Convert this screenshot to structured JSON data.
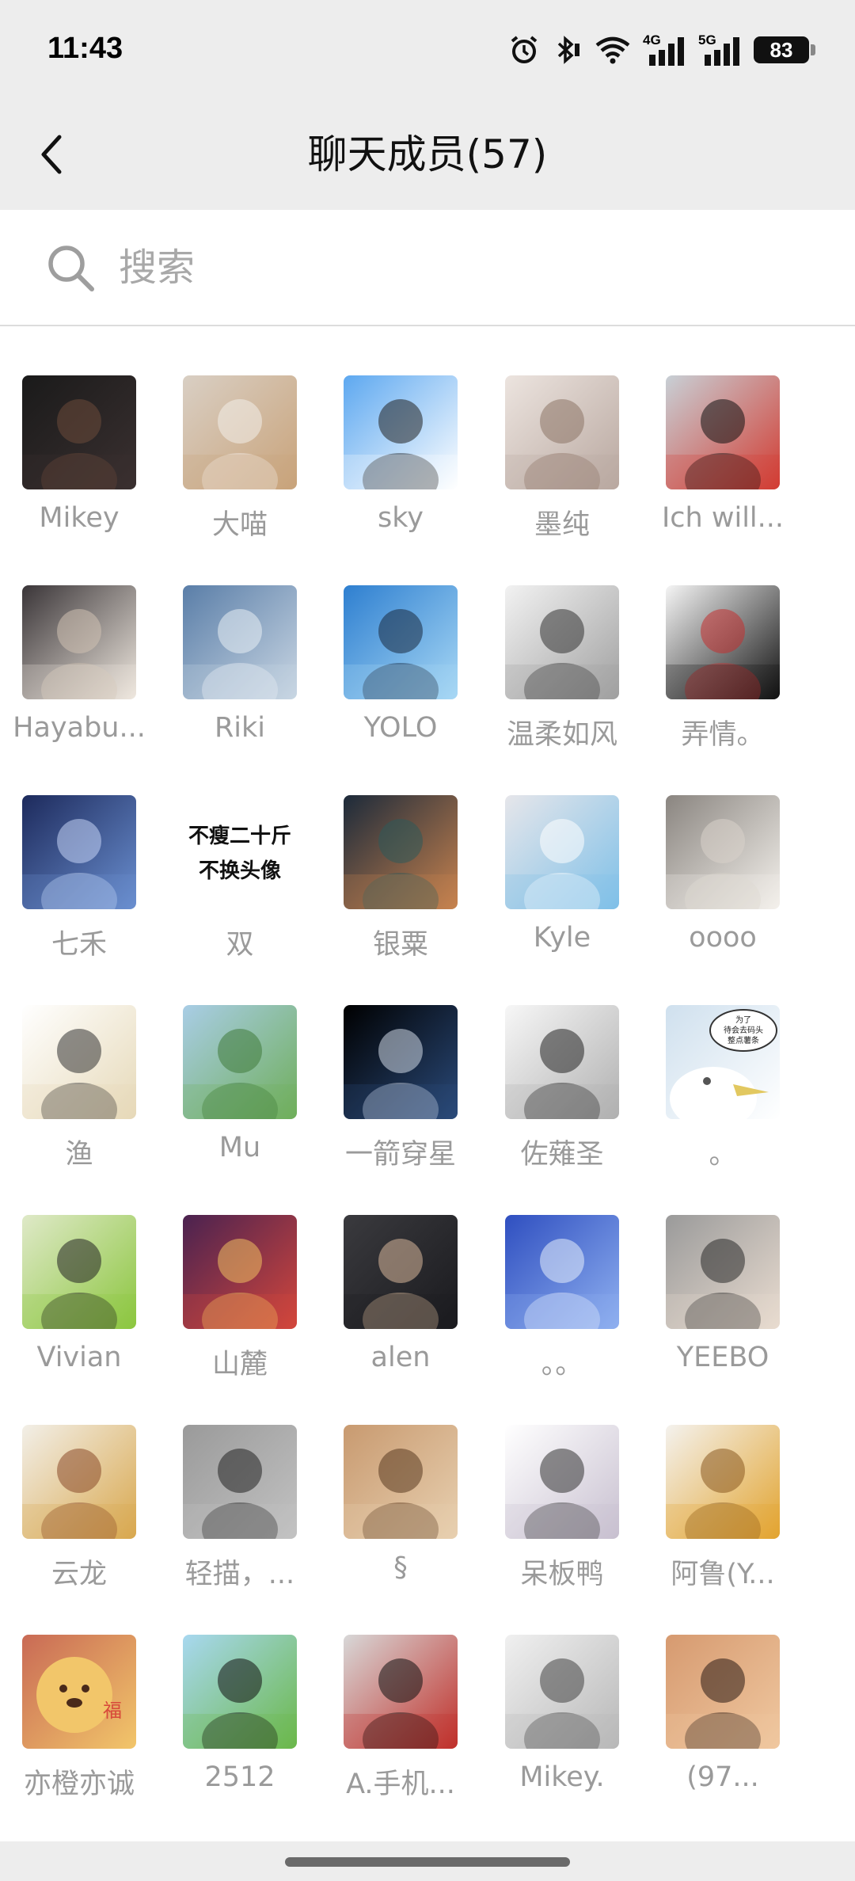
{
  "status": {
    "time": "11:43",
    "network_1": "4G",
    "network_2": "5G",
    "battery": "83"
  },
  "header": {
    "title": "聊天成员(57)"
  },
  "search": {
    "placeholder": "搜索"
  },
  "members": [
    {
      "name": "Mikey",
      "avatar": "night-car-photo",
      "colors": [
        "#1a1a1a",
        "#3a3030",
        "#6b4a3a"
      ]
    },
    {
      "name": "大喵",
      "avatar": "cat-with-bunny-ears",
      "colors": [
        "#d9cfc4",
        "#c9a37a",
        "#f3eee9"
      ]
    },
    {
      "name": "sky",
      "avatar": "cartoon-boy-glasses",
      "colors": [
        "#5da8f0",
        "#ffffff",
        "#222222"
      ]
    },
    {
      "name": "墨纯",
      "avatar": "faded-portrait",
      "colors": [
        "#ece4df",
        "#b9a8a0",
        "#8d7466"
      ]
    },
    {
      "name": "Ich will...",
      "avatar": "red-creature-glasses",
      "colors": [
        "#c8d0d6",
        "#d23c32",
        "#111111"
      ]
    },
    {
      "name": "Hayabu...",
      "avatar": "fluffy-hamster",
      "colors": [
        "#3a3538",
        "#efe8df",
        "#cfc1b2"
      ]
    },
    {
      "name": "Riki",
      "avatar": "clouds-from-above",
      "colors": [
        "#5a7ea8",
        "#c9d6e3",
        "#e8eef4"
      ]
    },
    {
      "name": "YOLO",
      "avatar": "anime-boy-sea",
      "colors": [
        "#2e7fd0",
        "#a8d8f5",
        "#1a2a40"
      ]
    },
    {
      "name": "温柔如风",
      "avatar": "sketch-masked-boy",
      "colors": [
        "#f2f2f2",
        "#a0a0a0",
        "#333333"
      ]
    },
    {
      "name": "弄情。",
      "avatar": "anime-boy-black-hair",
      "colors": [
        "#f5f5f5",
        "#111111",
        "#c33030"
      ]
    },
    {
      "name": "七禾",
      "avatar": "anime-character-blue",
      "colors": [
        "#1d2a5c",
        "#6a8fd0",
        "#c4d4f5"
      ]
    },
    {
      "name": "双",
      "avatar": "text-avatar",
      "colors": [
        "#ffffff",
        "#111111",
        "#111111"
      ],
      "text_lines": [
        "不瘦二十斤",
        "不换头像"
      ]
    },
    {
      "name": "银粟",
      "avatar": "anime-boy-hood",
      "colors": [
        "#1c2a3a",
        "#c7824e",
        "#2d5a5a"
      ]
    },
    {
      "name": "Kyle",
      "avatar": "bear-plush-blue",
      "colors": [
        "#e6e6ea",
        "#7fc0e8",
        "#ffffff"
      ]
    },
    {
      "name": "oooo",
      "avatar": "white-kitten",
      "colors": [
        "#8a8580",
        "#f4f1ec",
        "#d8d2ca"
      ]
    },
    {
      "name": "渔",
      "avatar": "chibi-blond-boy",
      "colors": [
        "#ffffff",
        "#e6d9b8",
        "#333333"
      ]
    },
    {
      "name": "Mu",
      "avatar": "landscape-field",
      "colors": [
        "#a9cde6",
        "#6fae5a",
        "#3f7a3a"
      ]
    },
    {
      "name": "一箭穿星",
      "avatar": "earth-from-space",
      "colors": [
        "#000000",
        "#2a4a7a",
        "#cfd8e6"
      ]
    },
    {
      "name": "佐薙圣",
      "avatar": "manga-girl-headphones",
      "colors": [
        "#f7f7f7",
        "#b0b0b0",
        "#222222"
      ]
    },
    {
      "name": "。",
      "avatar": "seagull-meme",
      "colors": [
        "#cfe0ee",
        "#ffffff",
        "#555555"
      ],
      "text_lines": [
        "为了",
        "待会去码头",
        "整点薯条"
      ]
    },
    {
      "name": "Vivian",
      "avatar": "green-cartoon-cat",
      "colors": [
        "#dfe9c8",
        "#8cc63f",
        "#222222"
      ]
    },
    {
      "name": "山麓",
      "avatar": "chibi-red-hair",
      "colors": [
        "#4a2250",
        "#d2463c",
        "#f0c060"
      ]
    },
    {
      "name": "alen",
      "avatar": "mirror-selfie",
      "colors": [
        "#3a3a3e",
        "#1a1a1e",
        "#d7b79a"
      ]
    },
    {
      "name": "。。",
      "avatar": "blue-hair-anime",
      "colors": [
        "#2f4fc0",
        "#8fb0f0",
        "#e6eefc"
      ]
    },
    {
      "name": "YEEBO",
      "avatar": "boy-with-kitten",
      "colors": [
        "#9a9a9a",
        "#e9dcd0",
        "#2a2a2a"
      ]
    },
    {
      "name": "云龙",
      "avatar": "mooncake-pastry",
      "colors": [
        "#f2efe8",
        "#d9a84e",
        "#8a4a2a"
      ]
    },
    {
      "name": "轻描，...",
      "avatar": "bicycle-wall",
      "colors": [
        "#9a9a9a",
        "#c2c2c2",
        "#222222"
      ]
    },
    {
      "name": "§",
      "avatar": "orange-cat",
      "colors": [
        "#c89a70",
        "#e8d0b0",
        "#5a3a20"
      ]
    },
    {
      "name": "呆板鸭",
      "avatar": "anime-girl-sketch",
      "colors": [
        "#ffffff",
        "#c8c0d0",
        "#333333"
      ]
    },
    {
      "name": "阿鲁(Y...",
      "avatar": "lion-cub-pin",
      "colors": [
        "#f4f2ee",
        "#e2a430",
        "#8a5a20"
      ]
    },
    {
      "name": "亦橙亦诚",
      "avatar": "orange-hamster",
      "colors": [
        "#c96a55",
        "#f2c66a",
        "#4a2a1a"
      ],
      "text_lines": [
        "福"
      ]
    },
    {
      "name": "2512",
      "avatar": "cartoon-boy-hill",
      "colors": [
        "#a8d8f0",
        "#6bb84a",
        "#111111"
      ]
    },
    {
      "name": "A.手机...",
      "avatar": "anime-boy-bus",
      "colors": [
        "#d8d8d8",
        "#c0302a",
        "#111111"
      ]
    },
    {
      "name": "Mikey.",
      "avatar": "anime-girls-manga",
      "colors": [
        "#f0f0f0",
        "#b8b8b8",
        "#444444"
      ]
    },
    {
      "name": "(97...",
      "avatar": "sunset-person",
      "colors": [
        "#d69a70",
        "#f0c8a0",
        "#2a1a14"
      ]
    }
  ]
}
